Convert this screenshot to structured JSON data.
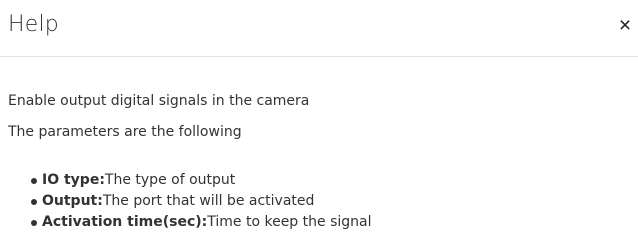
{
  "modal": {
    "title": "Help",
    "close_label": "×"
  },
  "body": {
    "intro": "Enable output digital signals in the camera",
    "params_heading": "The parameters are the following",
    "params": [
      {
        "name": "IO type:",
        "description": "The type of output"
      },
      {
        "name": "Output:",
        "description": "The port that will be activated"
      },
      {
        "name": "Activation time(sec):",
        "description": "Time to keep the signal"
      }
    ]
  }
}
